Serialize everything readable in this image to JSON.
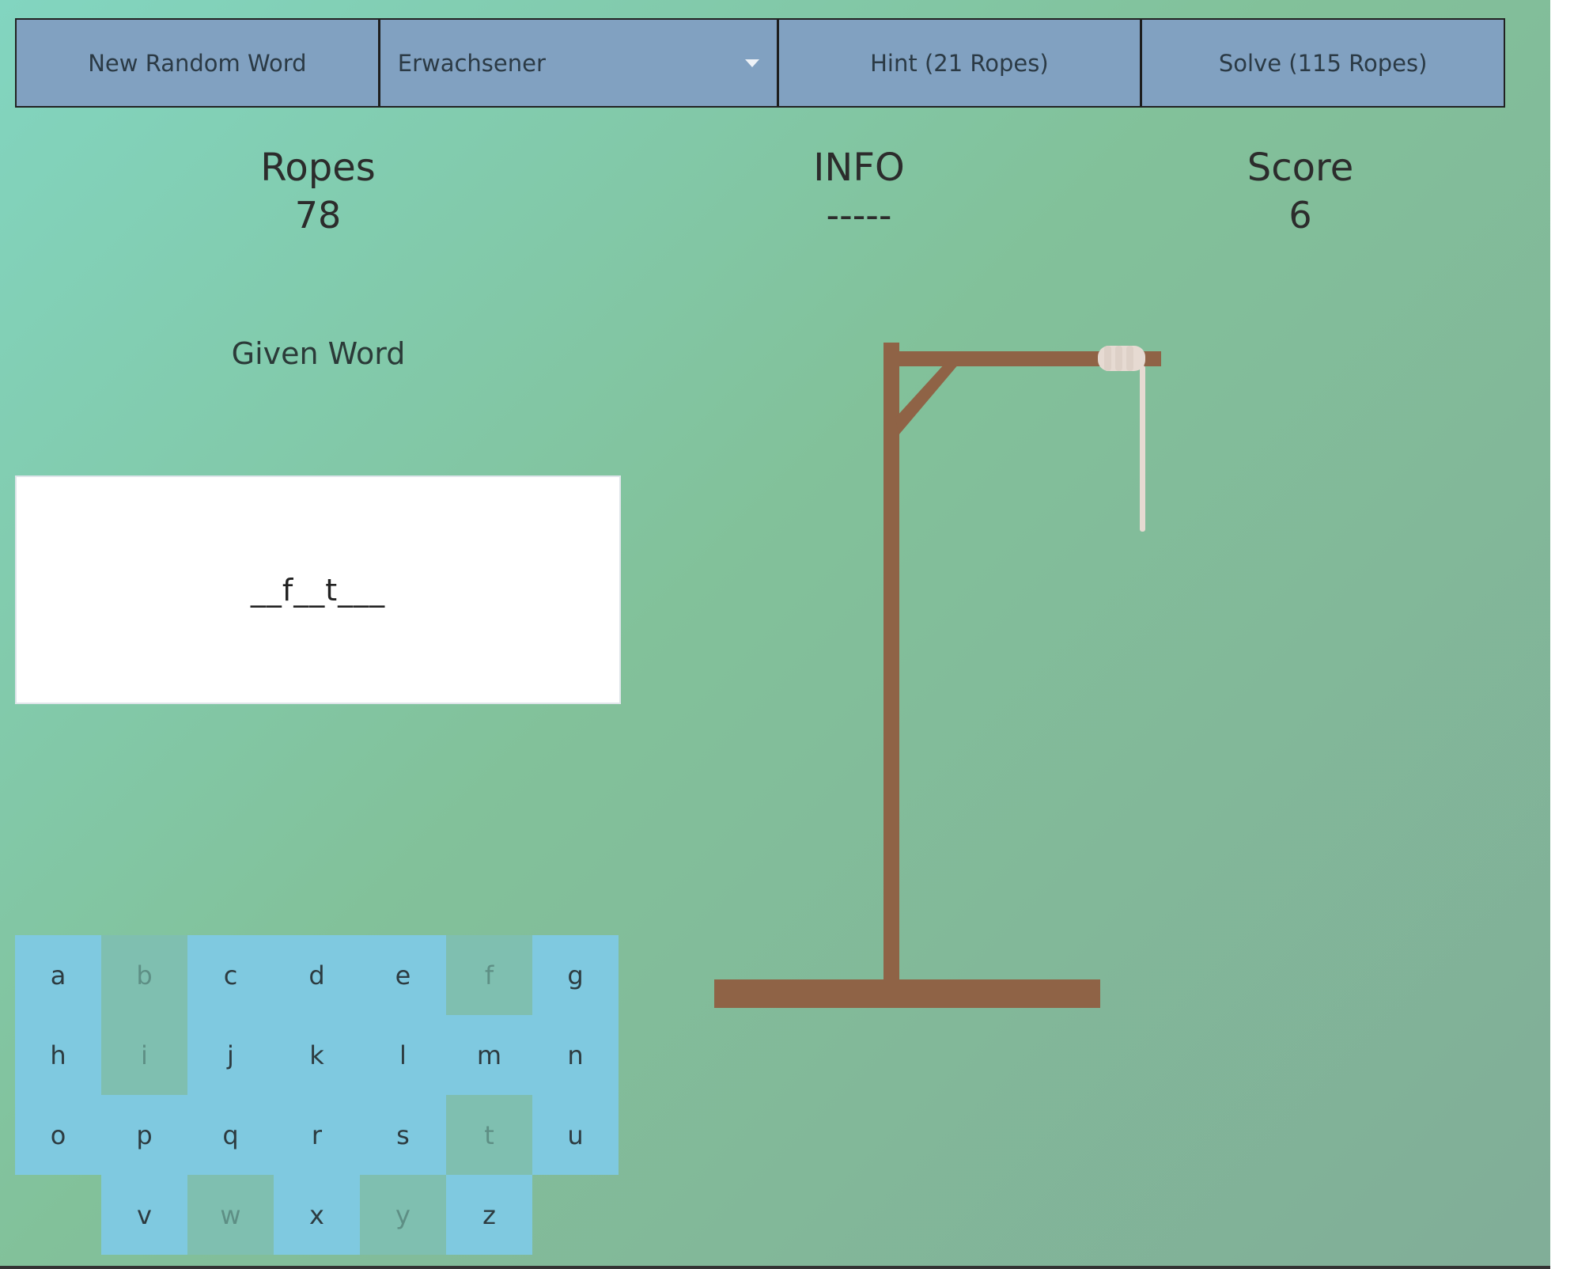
{
  "toolbar": {
    "new_word_label": "New Random Word",
    "difficulty_value": "Erwachsener",
    "hint_label": "Hint (21 Ropes)",
    "solve_label": "Solve (115 Ropes)"
  },
  "stats": {
    "ropes_label": "Ropes",
    "ropes_value": "78",
    "info_label": "INFO",
    "info_value": "-----",
    "score_label": "Score",
    "score_value": "6"
  },
  "word": {
    "label": "Given Word",
    "masked": "__f__t___"
  },
  "keyboard": {
    "keys": [
      {
        "letter": "a",
        "used": false
      },
      {
        "letter": "b",
        "used": true
      },
      {
        "letter": "c",
        "used": false
      },
      {
        "letter": "d",
        "used": false
      },
      {
        "letter": "e",
        "used": false
      },
      {
        "letter": "f",
        "used": true
      },
      {
        "letter": "g",
        "used": false
      },
      {
        "letter": "h",
        "used": false
      },
      {
        "letter": "i",
        "used": true
      },
      {
        "letter": "j",
        "used": false
      },
      {
        "letter": "k",
        "used": false
      },
      {
        "letter": "l",
        "used": false
      },
      {
        "letter": "m",
        "used": false
      },
      {
        "letter": "n",
        "used": false
      },
      {
        "letter": "o",
        "used": false
      },
      {
        "letter": "p",
        "used": false
      },
      {
        "letter": "q",
        "used": false
      },
      {
        "letter": "r",
        "used": false
      },
      {
        "letter": "s",
        "used": false
      },
      {
        "letter": "t",
        "used": true
      },
      {
        "letter": "u",
        "used": false
      },
      {
        "letter": "v",
        "used": false
      },
      {
        "letter": "w",
        "used": true
      },
      {
        "letter": "x",
        "used": false
      },
      {
        "letter": "y",
        "used": true
      },
      {
        "letter": "z",
        "used": false
      }
    ]
  },
  "colors": {
    "toolbar_bg": "#81a1c1",
    "key_bg": "#7fc9e0",
    "key_used_bg": "#7fbfb0",
    "wood": "#8f6346",
    "rope": "#e6dad2"
  }
}
